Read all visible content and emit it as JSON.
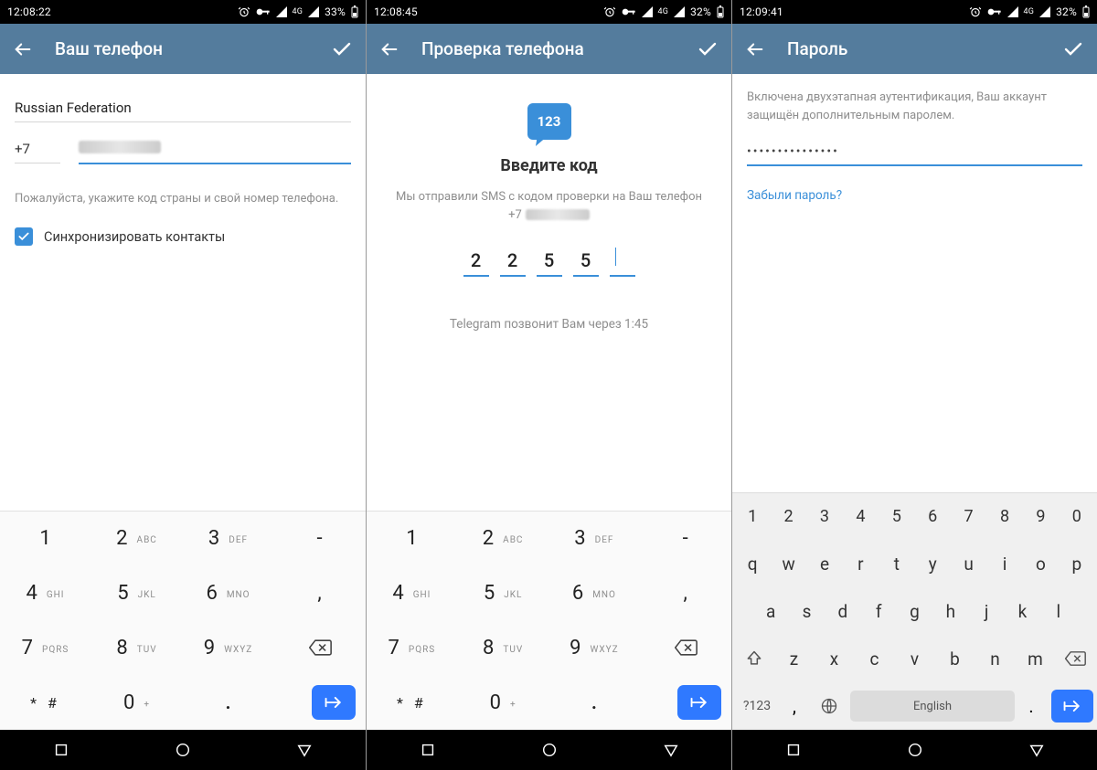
{
  "status": {
    "p1": {
      "time": "12:08:22",
      "battery": "33%"
    },
    "p2": {
      "time": "12:08:45",
      "battery": "32%"
    },
    "p3": {
      "time": "12:09:41",
      "battery": "32%"
    },
    "net_label": "4G"
  },
  "appbar": {
    "p1_title": "Ваш телефон",
    "p2_title": "Проверка телефона",
    "p3_title": "Пароль"
  },
  "phone_screen": {
    "country": "Russian Federation",
    "code": "+7",
    "hint": "Пожалуйста, укажите код страны и свой номер телефона.",
    "sync_label": "Синхронизировать контакты"
  },
  "verify_screen": {
    "bubble": "123",
    "title": "Введите код",
    "subtitle": "Мы отправили SMS с кодом проверки на Ваш телефон",
    "phone_prefix": "+7",
    "digits": [
      "2",
      "2",
      "5",
      "5",
      ""
    ],
    "foot": "Telegram позвонит Вам через 1:45"
  },
  "pwd_screen": {
    "desc": "Включена двухэтапная аутентификация, Ваш аккаунт защищён дополнительным паролем.",
    "mask": "•••••••••••••••",
    "forgot": "Забыли пароль?"
  },
  "numpad": {
    "keys": [
      [
        {
          "n": "1",
          "s": ""
        },
        {
          "n": "2",
          "s": "ABC"
        },
        {
          "n": "3",
          "s": "DEF"
        },
        {
          "n": "-",
          "s": ""
        }
      ],
      [
        {
          "n": "4",
          "s": "GHI"
        },
        {
          "n": "5",
          "s": "JKL"
        },
        {
          "n": "6",
          "s": "MNO"
        },
        {
          "n": ",",
          "s": ""
        }
      ],
      [
        {
          "n": "7",
          "s": "PQRS"
        },
        {
          "n": "8",
          "s": "TUV"
        },
        {
          "n": "9",
          "s": "WXYZ"
        },
        {
          "bk": true
        }
      ],
      [
        {
          "n": "* #",
          "star": true
        },
        {
          "n": "0",
          "s": "+"
        },
        {
          "n": ".",
          "dot": true
        },
        {
          "go": true
        }
      ]
    ]
  },
  "qwerty": {
    "numrow": [
      "1",
      "2",
      "3",
      "4",
      "5",
      "6",
      "7",
      "8",
      "9",
      "0"
    ],
    "row1": [
      "q",
      "w",
      "e",
      "r",
      "t",
      "y",
      "u",
      "i",
      "o",
      "p"
    ],
    "row2": [
      "a",
      "s",
      "d",
      "f",
      "g",
      "h",
      "j",
      "k",
      "l"
    ],
    "row3": [
      "z",
      "x",
      "c",
      "v",
      "b",
      "n",
      "m"
    ],
    "sym_label": "?123",
    "space_label": "English",
    "comma": ",",
    "period": "."
  }
}
